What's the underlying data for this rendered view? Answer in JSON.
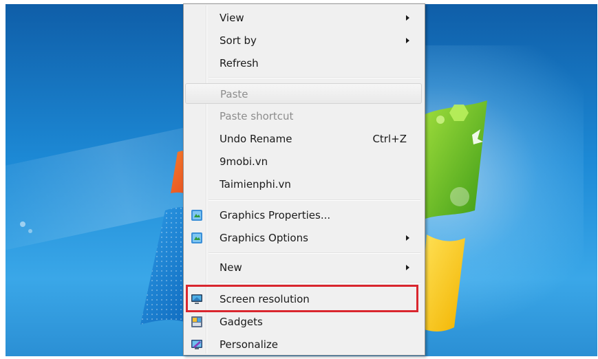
{
  "context_menu": {
    "items": [
      {
        "label": "View",
        "submenu": true
      },
      {
        "label": "Sort by",
        "submenu": true
      },
      {
        "label": "Refresh"
      },
      {
        "label": "Paste",
        "disabled": true
      },
      {
        "label": "Paste shortcut",
        "disabled": true
      },
      {
        "label": "Undo Rename",
        "shortcut": "Ctrl+Z"
      },
      {
        "label": "9mobi.vn"
      },
      {
        "label": "Taimienphi.vn"
      },
      {
        "label": "Graphics Properties...",
        "icon": "graphics-properties-icon"
      },
      {
        "label": "Graphics Options",
        "icon": "graphics-options-icon",
        "submenu": true
      },
      {
        "label": "New",
        "submenu": true
      },
      {
        "label": "Screen resolution",
        "icon": "screen-resolution-icon",
        "highlighted": true
      },
      {
        "label": "Gadgets",
        "icon": "gadgets-icon"
      },
      {
        "label": "Personalize",
        "icon": "personalize-icon"
      }
    ]
  },
  "colors": {
    "highlight_border": "#d9262e",
    "menu_background": "#f0f0f0",
    "desktop_blue": "#1d8ad6"
  }
}
